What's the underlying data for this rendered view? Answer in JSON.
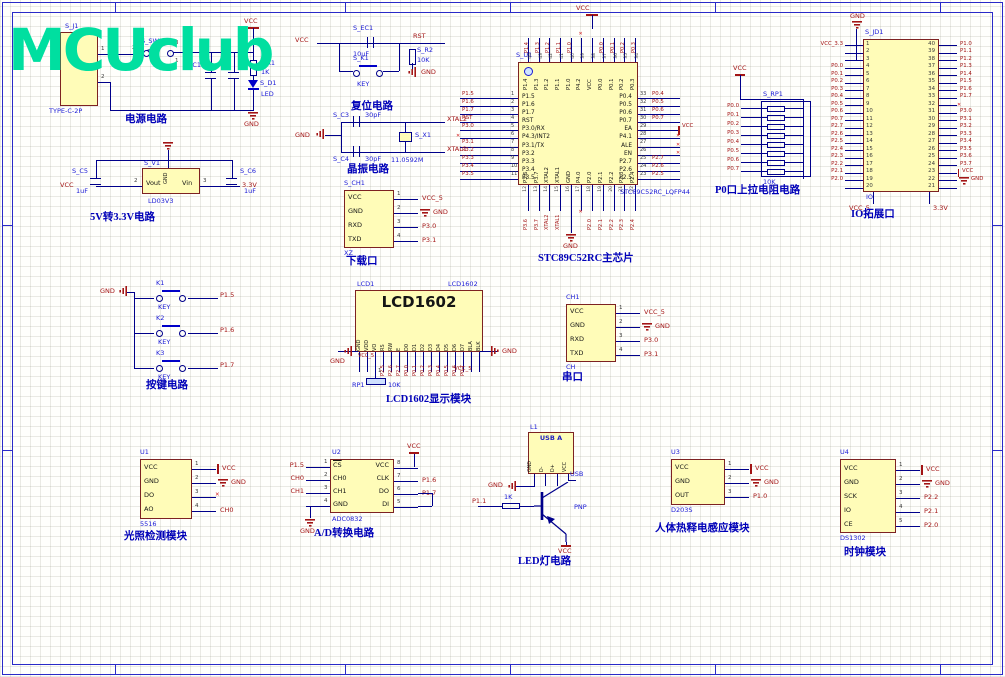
{
  "logo": {
    "text": "MCUclub",
    "color": "#00dfa0"
  },
  "power": {
    "caption": "电源电路",
    "j1_des": "S_J1",
    "j1_part": "TYPE-C-2P",
    "j1_pin1": "1",
    "j1_pin2": "2",
    "sw_des": "S_SW1",
    "sw_pin_l": "2",
    "sw_pin_t": "3",
    "sw_pin_b": "1",
    "c1_des": "S_C1",
    "c2_des": "C2",
    "r1_des": "S_R1",
    "r1_val": "1K",
    "d1_des": "S_D1",
    "d1_val": "LED",
    "vcc": "VCC",
    "gnd": "GND"
  },
  "reset": {
    "caption": "复位电路",
    "vcc": "VCC",
    "rst": "RST",
    "gnd": "GND",
    "ec1_des": "S_EC1",
    "ec1_val": "10uF",
    "k1_des": "S_K1",
    "k1_val": "KEY",
    "r2_des": "S_R2",
    "r2_val": "10K"
  },
  "xtal": {
    "caption": "晶振电路",
    "gnd": "GND",
    "c3_des": "S_C3",
    "c3_val": "30pF",
    "c4_des": "S_C4",
    "c4_val": "30pF",
    "x1_des": "S_X1",
    "x1_val": "11.0592M",
    "xtal2": "XTAL2",
    "xtal1": "XTAL1"
  },
  "mcu": {
    "caption": "STC89C52RC主芯片",
    "des": "S_U1",
    "part": "STC89C52RC_LQFP44",
    "vcc": "VCC",
    "gnd": "GND",
    "left": [
      {
        "num": "1",
        "name": "P1.5",
        "net": "P1.5"
      },
      {
        "num": "2",
        "name": "P1.6",
        "net": "P1.6"
      },
      {
        "num": "3",
        "name": "P1.7",
        "net": "P1.7"
      },
      {
        "num": "4",
        "name": "RST",
        "net": "RST"
      },
      {
        "num": "5",
        "name": "P3.0/RX",
        "net": "P3.0"
      },
      {
        "num": "6",
        "name": "P4.3/INT2",
        "net": "",
        "sym": "x"
      },
      {
        "num": "7",
        "name": "P3.1/TX",
        "net": "P3.1"
      },
      {
        "num": "8",
        "name": "P3.2",
        "net": "P3.2"
      },
      {
        "num": "9",
        "name": "P3.3",
        "net": "P3.3"
      },
      {
        "num": "10",
        "name": "P3.4",
        "net": "P3.4"
      },
      {
        "num": "11",
        "name": "P3.5",
        "net": "P3.5"
      }
    ],
    "right": [
      {
        "num": "33",
        "name": "P0.4",
        "net": "P0.4"
      },
      {
        "num": "32",
        "name": "P0.5",
        "net": "P0.5"
      },
      {
        "num": "31",
        "name": "P0.6",
        "net": "P0.6"
      },
      {
        "num": "30",
        "name": "P0.7",
        "net": "P0.7"
      },
      {
        "num": "29",
        "name": "EA",
        "net": "VCC",
        "sym": "vcc"
      },
      {
        "num": "28",
        "name": "P4.1",
        "net": "",
        "sym": "x"
      },
      {
        "num": "27",
        "name": "ALE",
        "net": "",
        "sym": "x"
      },
      {
        "num": "26",
        "name": "EN",
        "net": "",
        "sym": "x"
      },
      {
        "num": "25",
        "name": "P2.7",
        "net": "P2.7"
      },
      {
        "num": "24",
        "name": "P2.6",
        "net": "P2.6"
      },
      {
        "num": "23",
        "name": "P2.5",
        "net": "P2.5"
      }
    ],
    "top": [
      {
        "num": "44",
        "name": "P1.4",
        "net": "P1.4"
      },
      {
        "num": "43",
        "name": "P1.3",
        "net": "P1.3"
      },
      {
        "num": "42",
        "name": "P1.2",
        "net": "P1.2"
      },
      {
        "num": "41",
        "name": "P1.1",
        "net": "P1.1"
      },
      {
        "num": "40",
        "name": "P1.0",
        "net": "P1.0"
      },
      {
        "num": "39",
        "name": "P4.2",
        "net": "",
        "sym": "x"
      },
      {
        "num": "38",
        "name": "VCC",
        "net": ""
      },
      {
        "num": "37",
        "name": "P0.0",
        "net": "P0.0"
      },
      {
        "num": "36",
        "name": "P0.1",
        "net": "P0.1"
      },
      {
        "num": "35",
        "name": "P0.2",
        "net": "P0.2"
      },
      {
        "num": "34",
        "name": "P0.3",
        "net": "P0.3"
      }
    ],
    "bottom": [
      {
        "num": "12",
        "name": "P3.6",
        "net": "P3.6"
      },
      {
        "num": "13",
        "name": "P3.7",
        "net": "P3.7"
      },
      {
        "num": "14",
        "name": "XTAL2",
        "net": "XTAL2"
      },
      {
        "num": "15",
        "name": "XTAL1",
        "net": "XTAL1"
      },
      {
        "num": "16",
        "name": "GND",
        "net": ""
      },
      {
        "num": "17",
        "name": "P4.0",
        "net": "",
        "sym": "x"
      },
      {
        "num": "18",
        "name": "P2.0",
        "net": "P2.0"
      },
      {
        "num": "19",
        "name": "P2.1",
        "net": "P2.1"
      },
      {
        "num": "20",
        "name": "P2.2",
        "net": "P2.2"
      },
      {
        "num": "21",
        "name": "P2.3",
        "net": "P2.3"
      },
      {
        "num": "22",
        "name": "P2.4",
        "net": "P2.4"
      }
    ]
  },
  "pullup": {
    "caption": "P0口上拉电阻电路",
    "des": "S_RP1",
    "val": "10K",
    "vcc": "VCC",
    "rows": [
      {
        "net": "P0.0"
      },
      {
        "net": "P0.1"
      },
      {
        "net": "P0.2"
      },
      {
        "net": "P0.3"
      },
      {
        "net": "P0.4"
      },
      {
        "net": "P0.5"
      },
      {
        "net": "P0.6"
      },
      {
        "net": "P0.7"
      }
    ]
  },
  "io": {
    "caption": "IO拓展口",
    "des": "S_JD1",
    "label": "IO",
    "gnd_top": "GND",
    "vcc33": "VCC_3.3",
    "vcc5": "VCC_5",
    "v33": "3.3V",
    "rows": [
      {
        "ln": "1",
        "rn": "40",
        "lnet": "VCC_3.3",
        "rnet": "P1.0"
      },
      {
        "ln": "2",
        "rn": "39",
        "lnet": "",
        "rnet": "P1.1"
      },
      {
        "ln": "3",
        "rn": "38",
        "lnet": "",
        "rnet": "P1.2"
      },
      {
        "ln": "4",
        "rn": "37",
        "lnet": "P0.0",
        "rnet": "P1.3"
      },
      {
        "ln": "5",
        "rn": "36",
        "lnet": "P0.1",
        "rnet": "P1.4"
      },
      {
        "ln": "6",
        "rn": "35",
        "lnet": "P0.2",
        "rnet": "P1.5"
      },
      {
        "ln": "7",
        "rn": "34",
        "lnet": "P0.3",
        "rnet": "P1.6"
      },
      {
        "ln": "8",
        "rn": "33",
        "lnet": "P0.4",
        "rnet": "P1.7"
      },
      {
        "ln": "9",
        "rn": "32",
        "lnet": "P0.5",
        "rnet": "",
        "rsym": "x"
      },
      {
        "ln": "10",
        "rn": "31",
        "lnet": "P0.6",
        "rnet": "P3.0"
      },
      {
        "ln": "11",
        "rn": "30",
        "lnet": "P0.7",
        "rnet": "P3.1"
      },
      {
        "ln": "12",
        "rn": "29",
        "lnet": "P2.7",
        "rnet": "P3.2"
      },
      {
        "ln": "13",
        "rn": "28",
        "lnet": "P2.6",
        "rnet": "P3.3"
      },
      {
        "ln": "14",
        "rn": "27",
        "lnet": "P2.5",
        "rnet": "P3.4"
      },
      {
        "ln": "15",
        "rn": "26",
        "lnet": "P2.4",
        "rnet": "P3.5"
      },
      {
        "ln": "16",
        "rn": "25",
        "lnet": "P2.3",
        "rnet": "P3.6"
      },
      {
        "ln": "17",
        "rn": "24",
        "lnet": "P2.2",
        "rnet": "P3.7"
      },
      {
        "ln": "18",
        "rn": "23",
        "lnet": "P2.1",
        "rnet": "VCC",
        "rsym": "vcc"
      },
      {
        "ln": "19",
        "rn": "22",
        "lnet": "P2.0",
        "rnet": "GND",
        "rsym": "gnd"
      },
      {
        "ln": "20",
        "rn": "21",
        "lnet": "",
        "rnet": ""
      }
    ]
  },
  "ldo": {
    "caption": "5V转3.3V电路",
    "des": "S_V1",
    "part": "LD03V3",
    "vcc": "VCC",
    "v33": "3.3V",
    "gnd_name": "GND",
    "vout": "Vout",
    "vin": "Vin",
    "p2": "2",
    "p3": "3",
    "c5_des": "S_C5",
    "c5_val": "1uF",
    "c6_des": "S_C6",
    "c6_val": "1uF"
  },
  "dl": {
    "caption": "下载口",
    "des": "S_CH1",
    "label": "XZ",
    "pins": [
      {
        "name": "VCC",
        "num": "1",
        "net": "VCC_5"
      },
      {
        "name": "GND",
        "num": "2",
        "net": "GND",
        "sym": "gnd"
      },
      {
        "name": "RXD",
        "num": "3",
        "net": "P3.0"
      },
      {
        "name": "TXD",
        "num": "4",
        "net": "P3.1"
      }
    ]
  },
  "keys": {
    "caption": "按键电路",
    "gnd": "GND",
    "items": [
      {
        "des": "K1",
        "val": "KEY",
        "net": "P1.5"
      },
      {
        "des": "K2",
        "val": "KEY",
        "net": "P1.6"
      },
      {
        "des": "K3",
        "val": "KEY",
        "net": "P1.7"
      }
    ]
  },
  "lcd": {
    "caption": "LCD1602显示模块",
    "des": "LCD1",
    "part": "LCD1602",
    "title": "LCD1602",
    "gnd": "GND",
    "vcc5": "VCC_5",
    "pot_des": "RP1",
    "pot_val": "10K",
    "pot_pin": "1",
    "cols": [
      {
        "name": "GND",
        "net": ""
      },
      {
        "name": "VDD",
        "net": ""
      },
      {
        "name": "VO",
        "net": ""
      },
      {
        "name": "RS",
        "net": "P2.5"
      },
      {
        "name": "RW",
        "net": "P2.6"
      },
      {
        "name": "E",
        "net": "P2.7"
      },
      {
        "name": "D0",
        "net": "P0.0"
      },
      {
        "name": "D1",
        "net": "P0.1"
      },
      {
        "name": "D2",
        "net": "P0.2"
      },
      {
        "name": "D3",
        "net": "P0.3"
      },
      {
        "name": "D4",
        "net": "P0.4"
      },
      {
        "name": "D5",
        "net": "P0.5"
      },
      {
        "name": "D6",
        "net": "P0.6"
      },
      {
        "name": "D7",
        "net": "P0.7"
      },
      {
        "name": "BLA",
        "net": ""
      },
      {
        "name": "BLK",
        "net": ""
      }
    ]
  },
  "serial": {
    "caption": "串口",
    "des": "CH1",
    "label": "CH",
    "pins": [
      {
        "name": "VCC",
        "num": "1",
        "net": "VCC_5"
      },
      {
        "name": "GND",
        "num": "2",
        "net": "GND",
        "sym": "gnd"
      },
      {
        "name": "RXD",
        "num": "3",
        "net": "P3.0"
      },
      {
        "name": "TXD",
        "num": "4",
        "net": "P3.1"
      }
    ]
  },
  "light": {
    "caption": "光照检测模块",
    "des": "U1",
    "part": "5516",
    "pins": [
      {
        "name": "VCC",
        "num": "1",
        "net": "VCC",
        "sym": "vcc"
      },
      {
        "name": "GND",
        "num": "2",
        "net": "GND",
        "sym": "gnd"
      },
      {
        "name": "DO",
        "num": "3",
        "net": "",
        "sym": "x"
      },
      {
        "name": "AO",
        "num": "4",
        "net": "CH0"
      }
    ]
  },
  "adc": {
    "caption": "A/D转换电路",
    "des": "U2",
    "part": "ADC0832",
    "vcc": "VCC",
    "gnd": "GND",
    "left": [
      {
        "name": "CS",
        "num": "1",
        "net": "P1.5",
        "bar": true
      },
      {
        "name": "CH0",
        "num": "2",
        "net": "CH0"
      },
      {
        "name": "CH1",
        "num": "3",
        "net": "CH1"
      },
      {
        "name": "GND",
        "num": "4",
        "net": ""
      }
    ],
    "right": [
      {
        "name": "VCC",
        "num": "8",
        "net": ""
      },
      {
        "name": "CLK",
        "num": "7",
        "net": "P1.6"
      },
      {
        "name": "DO",
        "num": "6",
        "net": "P1.7"
      },
      {
        "name": "DI",
        "num": "5",
        "net": ""
      }
    ]
  },
  "led": {
    "caption": "LED灯电路",
    "des": "L1",
    "part": "USB A",
    "usb": "USB",
    "gnd": "GND",
    "vcc": "VCC",
    "base_net": "P1.1",
    "r_val": "1K",
    "q_label": "PNP",
    "pins": [
      {
        "name": "GND"
      },
      {
        "name": "D-"
      },
      {
        "name": "D+"
      },
      {
        "name": "VCC"
      }
    ]
  },
  "pir": {
    "caption": "人体热释电感应模块",
    "des": "U3",
    "part": "D203S",
    "pins": [
      {
        "name": "VCC",
        "num": "1",
        "net": "VCC",
        "sym": "vcc"
      },
      {
        "name": "GND",
        "num": "2",
        "net": "GND",
        "sym": "gnd"
      },
      {
        "name": "OUT",
        "num": "3",
        "net": "P1.0"
      }
    ]
  },
  "clock": {
    "caption": "时钟模块",
    "des": "U4",
    "part": "DS1302",
    "pins": [
      {
        "name": "VCC",
        "num": "1",
        "net": "VCC",
        "sym": "vcc"
      },
      {
        "name": "GND",
        "num": "2",
        "net": "GND",
        "sym": "gnd"
      },
      {
        "name": "SCK",
        "num": "3",
        "net": "P2.2"
      },
      {
        "name": "IO",
        "num": "4",
        "net": "P2.1"
      },
      {
        "name": "CE",
        "num": "5",
        "net": "P2.0"
      }
    ]
  }
}
